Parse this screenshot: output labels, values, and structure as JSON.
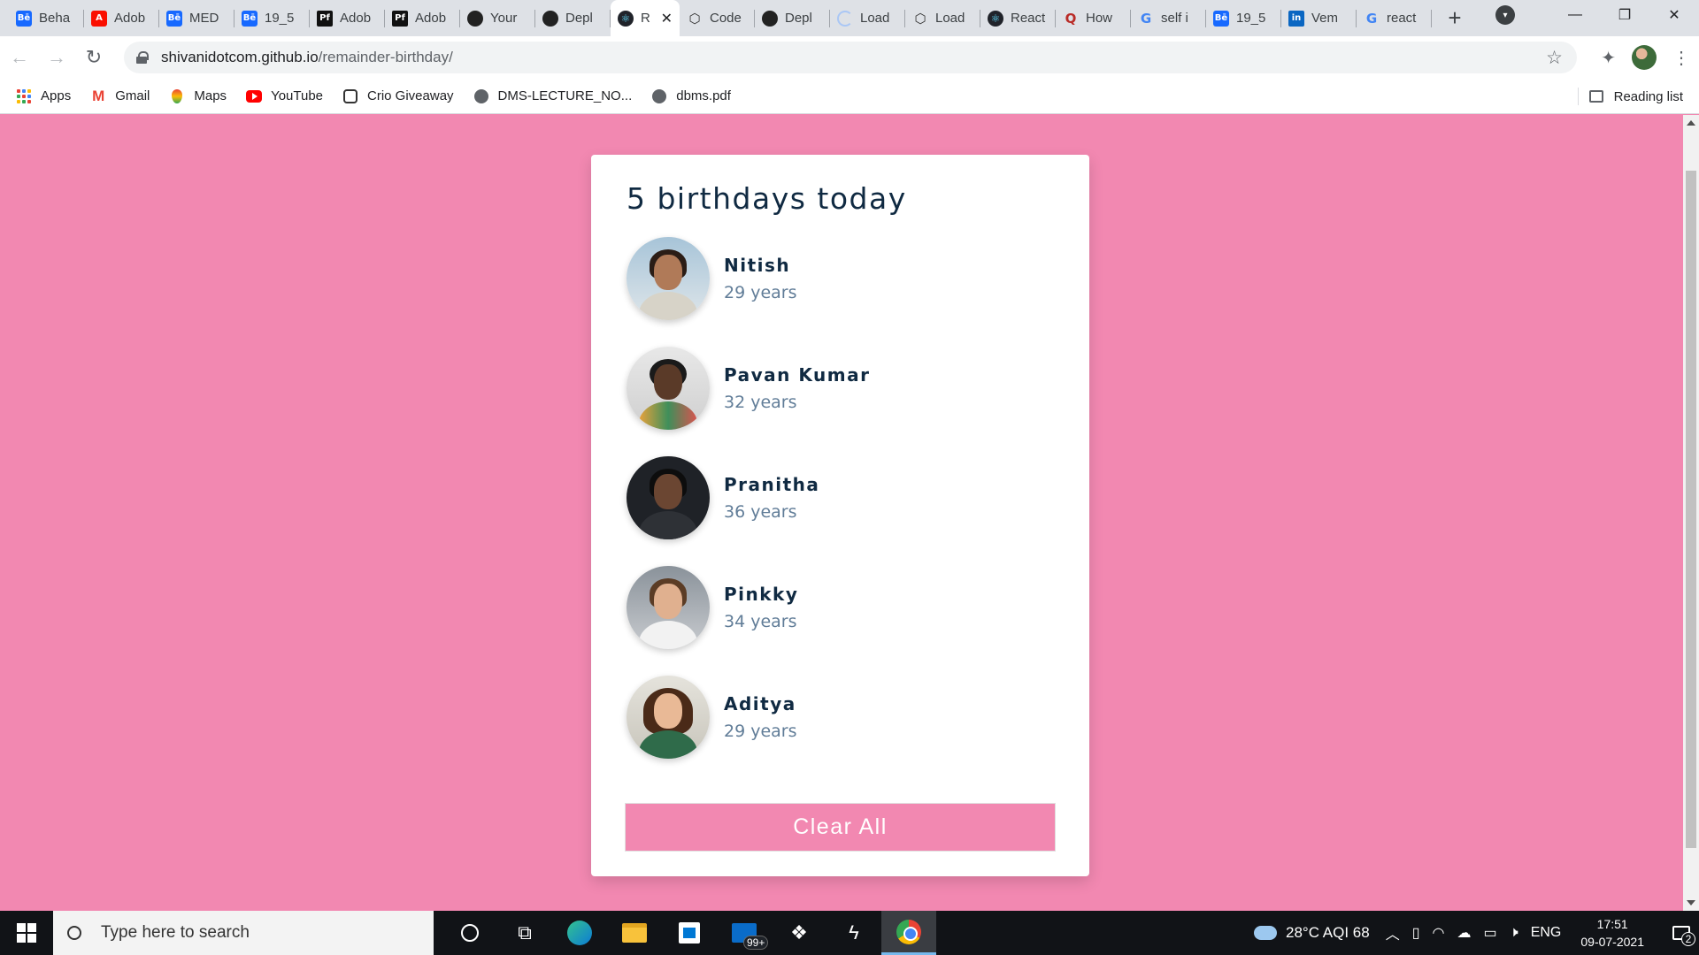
{
  "browser": {
    "tabs": [
      {
        "label": "Beha",
        "icon": "behance-icon"
      },
      {
        "label": "Adob",
        "icon": "adobe-icon"
      },
      {
        "label": "MED",
        "icon": "behance-icon"
      },
      {
        "label": "19_5",
        "icon": "behance-icon"
      },
      {
        "label": "Adob",
        "icon": "portfolio-icon"
      },
      {
        "label": "Adob",
        "icon": "portfolio-icon"
      },
      {
        "label": "Your",
        "icon": "github-icon"
      },
      {
        "label": "Depl",
        "icon": "github-icon"
      },
      {
        "label": "R",
        "icon": "react-icon",
        "active": true
      },
      {
        "label": "Code",
        "icon": "codesandbox-icon"
      },
      {
        "label": "Depl",
        "icon": "github-icon"
      },
      {
        "label": "Load",
        "icon": "loading-icon"
      },
      {
        "label": "Load",
        "icon": "codesandbox-icon"
      },
      {
        "label": "React",
        "icon": "react-icon"
      },
      {
        "label": "How",
        "icon": "quora-icon"
      },
      {
        "label": "self i",
        "icon": "google-icon"
      },
      {
        "label": "19_5",
        "icon": "behance-icon"
      },
      {
        "label": "Vem",
        "icon": "linkedin-icon"
      },
      {
        "label": "react",
        "icon": "google-icon"
      }
    ],
    "url_host": "shivanidotcom.github.io",
    "url_path": "/remainder-birthday/",
    "bookmarks": [
      {
        "label": "Apps",
        "icon": "apps-grid-icon"
      },
      {
        "label": "Gmail",
        "icon": "gmail-icon"
      },
      {
        "label": "Maps",
        "icon": "maps-icon"
      },
      {
        "label": "YouTube",
        "icon": "youtube-icon"
      },
      {
        "label": "Crio Giveaway",
        "icon": "crio-icon"
      },
      {
        "label": "DMS-LECTURE_NO...",
        "icon": "globe-icon"
      },
      {
        "label": "dbms.pdf",
        "icon": "globe-icon"
      }
    ],
    "reading_list": "Reading list"
  },
  "page": {
    "title": "5 birthdays today",
    "people": [
      {
        "name": "Nitish",
        "age": "29 years"
      },
      {
        "name": "Pavan Kumar",
        "age": "32 years"
      },
      {
        "name": "Pranitha",
        "age": "36 years"
      },
      {
        "name": "Pinkky",
        "age": "34 years"
      },
      {
        "name": "Aditya",
        "age": "29 years"
      }
    ],
    "clear_label": "Clear All",
    "colors": {
      "background": "#f288b1",
      "heading": "#102a42",
      "age": "#617d98"
    }
  },
  "taskbar": {
    "search_placeholder": "Type here to search",
    "mail_badge": "99+",
    "weather": "28°C  AQI 68",
    "language": "ENG",
    "time": "17:51",
    "date": "09-07-2021",
    "notifications": "2"
  }
}
